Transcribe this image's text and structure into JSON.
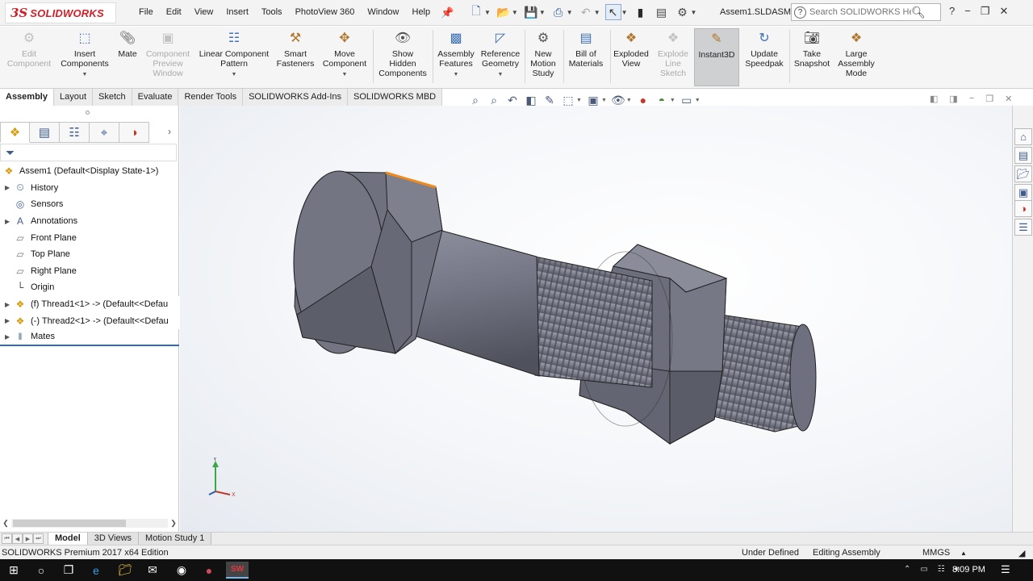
{
  "app": {
    "logo_ds": "3S",
    "logo_text": "SOLIDWORKS",
    "document_name": "Assem1.SLDASM"
  },
  "menus": [
    "File",
    "Edit",
    "View",
    "Insert",
    "Tools",
    "PhotoView 360",
    "Window",
    "Help"
  ],
  "help_search": {
    "placeholder": "Search SOLIDWORKS Help"
  },
  "ribbon": {
    "edit_component": "Edit\nComponent",
    "insert_components": "Insert\nComponents",
    "mate": "Mate",
    "component_preview": "Component\nPreview\nWindow",
    "linear_pattern": "Linear Component\nPattern",
    "smart_fasteners": "Smart\nFasteners",
    "move_component": "Move\nComponent",
    "show_hidden": "Show\nHidden\nComponents",
    "assembly_features": "Assembly\nFeatures",
    "reference_geometry": "Reference\nGeometry",
    "new_motion_study": "New\nMotion\nStudy",
    "bill_of_materials": "Bill of\nMaterials",
    "exploded_view": "Exploded\nView",
    "explode_line_sketch": "Explode\nLine\nSketch",
    "instant3d": "Instant3D",
    "update_speedpak": "Update\nSpeedpak",
    "take_snapshot": "Take\nSnapshot",
    "large_assembly_mode": "Large\nAssembly\nMode"
  },
  "command_tabs": [
    "Assembly",
    "Layout",
    "Sketch",
    "Evaluate",
    "Render Tools",
    "SOLIDWORKS Add-Ins",
    "SOLIDWORKS MBD"
  ],
  "tree": {
    "root": "Assem1  (Default<Display State-1>)",
    "items": [
      {
        "label": "History",
        "expandable": true
      },
      {
        "label": "Sensors",
        "expandable": false
      },
      {
        "label": "Annotations",
        "expandable": true
      },
      {
        "label": "Front Plane",
        "expandable": false
      },
      {
        "label": "Top Plane",
        "expandable": false
      },
      {
        "label": "Right Plane",
        "expandable": false
      },
      {
        "label": "Origin",
        "expandable": false
      },
      {
        "label": "(f) Thread1<1> -> (Default<<Defau",
        "expandable": true
      },
      {
        "label": "(-) Thread2<1> -> (Default<<Defau",
        "expandable": true
      },
      {
        "label": "Mates",
        "expandable": true
      }
    ]
  },
  "bottom_tabs": [
    "Model",
    "3D Views",
    "Motion Study 1"
  ],
  "status": {
    "edition": "SOLIDWORKS Premium 2017 x64 Edition",
    "definition": "Under Defined",
    "mode": "Editing Assembly",
    "units": "MMGS"
  },
  "taskbar": {
    "clock": "8:09 PM"
  },
  "colors": {
    "accent": "#2e6ac0",
    "brand_red": "#d21f26",
    "part_gray": "#737582",
    "highlight_edge": "#f08a1c"
  }
}
